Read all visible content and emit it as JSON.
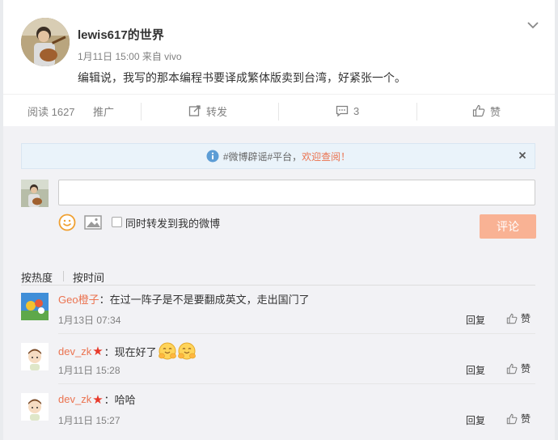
{
  "post": {
    "username": "lewis617的世界",
    "meta": "1月11日 15:00 来自 vivo",
    "text": "编辑说，我写的那本编程书要译成繁体版卖到台湾，好紧张一个。"
  },
  "actions": {
    "read": "阅读 1627",
    "promote": "推广",
    "forward": "转发",
    "comment_count": "3",
    "like": "赞"
  },
  "notice": {
    "text": "#微博辟谣#平台，",
    "link": "欢迎查阅！"
  },
  "composer": {
    "placeholder": "",
    "forward_label": "同时转发到我的微博",
    "submit_label": "评论"
  },
  "sort": {
    "hot": "按热度",
    "time": "按时间"
  },
  "comments": [
    {
      "name": "Geo橙子",
      "text": "：在过一阵子是不是要翻成英文，走出国门了",
      "time": "1月13日 07:34",
      "reply": "回复",
      "like": "赞"
    },
    {
      "name": "dev_zk",
      "text": "：现在好了",
      "time": "1月11日 15:28",
      "reply": "回复",
      "like": "赞"
    },
    {
      "name": "dev_zk",
      "text": "：哈哈",
      "time": "1月11日 15:27",
      "reply": "回复",
      "like": "赞"
    }
  ],
  "colors": {
    "accent": "#eb7350",
    "submit": "#f9b294",
    "notice_bg": "#eaf3fa"
  }
}
